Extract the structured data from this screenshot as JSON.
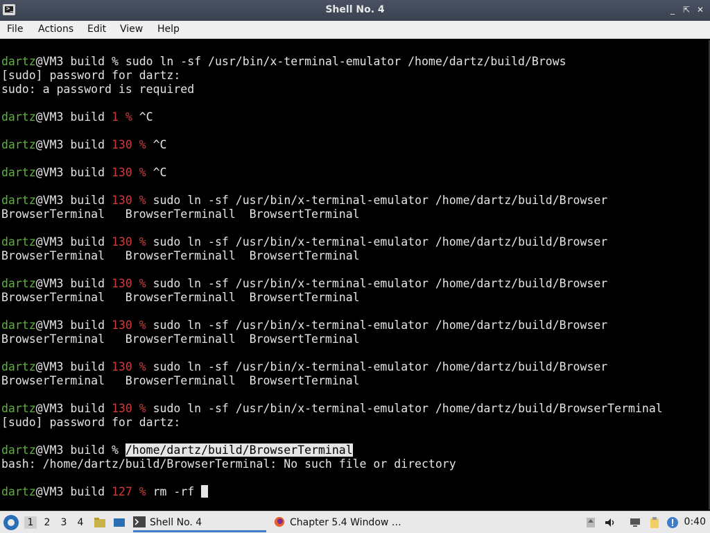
{
  "window": {
    "title": "Shell No. 4",
    "buttons": {
      "minimize": "_",
      "maximize": "⇱",
      "close": "✕"
    }
  },
  "menubar": [
    "File",
    "Actions",
    "Edit",
    "View",
    "Help"
  ],
  "terminal": {
    "lines": [
      {
        "user": "dartz",
        "host": "@VM3 build ",
        "code": "",
        "prompt": "% ",
        "cmd": "sudo ln -sf /usr/bin/x-terminal-emulator /home/dartz/build/Brows"
      },
      {
        "text": "[sudo] password for dartz:"
      },
      {
        "text": "sudo: a password is required"
      },
      {
        "text": ""
      },
      {
        "user": "dartz",
        "host": "@VM3 build ",
        "code": "1 ",
        "prompt": "% ",
        "cmd": "^C"
      },
      {
        "text": ""
      },
      {
        "user": "dartz",
        "host": "@VM3 build ",
        "code": "130 ",
        "prompt": "% ",
        "cmd": "^C"
      },
      {
        "text": ""
      },
      {
        "user": "dartz",
        "host": "@VM3 build ",
        "code": "130 ",
        "prompt": "% ",
        "cmd": "^C"
      },
      {
        "text": ""
      },
      {
        "user": "dartz",
        "host": "@VM3 build ",
        "code": "130 ",
        "prompt": "% ",
        "cmd": "sudo ln -sf /usr/bin/x-terminal-emulator /home/dartz/build/Browser"
      },
      {
        "text": "BrowserTerminal   BrowserTerminall  BrowsertTerminal"
      },
      {
        "text": ""
      },
      {
        "user": "dartz",
        "host": "@VM3 build ",
        "code": "130 ",
        "prompt": "% ",
        "cmd": "sudo ln -sf /usr/bin/x-terminal-emulator /home/dartz/build/Browser"
      },
      {
        "text": "BrowserTerminal   BrowserTerminall  BrowsertTerminal"
      },
      {
        "text": ""
      },
      {
        "user": "dartz",
        "host": "@VM3 build ",
        "code": "130 ",
        "prompt": "% ",
        "cmd": "sudo ln -sf /usr/bin/x-terminal-emulator /home/dartz/build/Browser"
      },
      {
        "text": "BrowserTerminal   BrowserTerminall  BrowsertTerminal"
      },
      {
        "text": ""
      },
      {
        "user": "dartz",
        "host": "@VM3 build ",
        "code": "130 ",
        "prompt": "% ",
        "cmd": "sudo ln -sf /usr/bin/x-terminal-emulator /home/dartz/build/Browser"
      },
      {
        "text": "BrowserTerminal   BrowserTerminall  BrowsertTerminal"
      },
      {
        "text": ""
      },
      {
        "user": "dartz",
        "host": "@VM3 build ",
        "code": "130 ",
        "prompt": "% ",
        "cmd": "sudo ln -sf /usr/bin/x-terminal-emulator /home/dartz/build/Browser"
      },
      {
        "text": "BrowserTerminal   BrowserTerminall  BrowsertTerminal"
      },
      {
        "text": ""
      },
      {
        "user": "dartz",
        "host": "@VM3 build ",
        "code": "130 ",
        "prompt": "% ",
        "cmd": "sudo ln -sf /usr/bin/x-terminal-emulator /home/dartz/build/BrowserTerminal"
      },
      {
        "text": "[sudo] password for dartz:"
      },
      {
        "text": ""
      },
      {
        "user": "dartz",
        "host": "@VM3 build ",
        "code": "",
        "prompt": "% ",
        "cmd": "/home/dartz/build/BrowserTerminal",
        "highlight": true
      },
      {
        "text": "bash: /home/dartz/build/BrowserTerminal: No such file or directory"
      },
      {
        "text": ""
      },
      {
        "user": "dartz",
        "host": "@VM3 build ",
        "code": "127 ",
        "prompt": "% ",
        "cmd": "rm -rf ",
        "cursor": true
      }
    ]
  },
  "taskbar": {
    "workspaces": [
      "1",
      "2",
      "3",
      "4"
    ],
    "tasks": [
      {
        "label": "Shell No. 4",
        "icon": "terminal-icon"
      },
      {
        "label": "Chapter 5.4 Window …",
        "icon": "firefox-icon"
      }
    ],
    "clock": "0:40"
  },
  "colors": {
    "user": "#5fb33a",
    "exit_code": "#d03a3a",
    "text": "#e5e5e5",
    "background": "#000000"
  }
}
